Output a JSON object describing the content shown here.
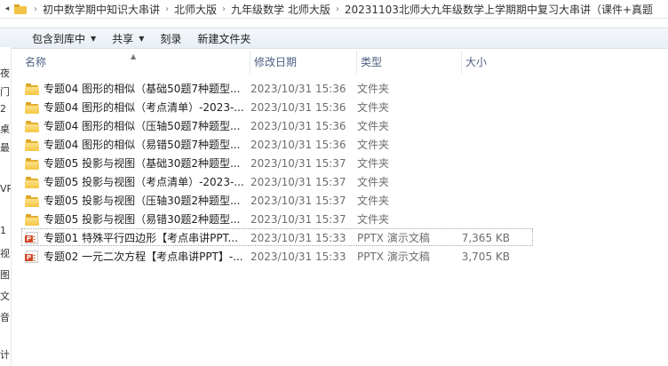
{
  "address_bar": {
    "crumbs": [
      "初中数学期中知识大串讲",
      "北师大版",
      "九年级数学 北师大版",
      "20231103北师大九年级数学上学期期中复习大串讲（课件+真题"
    ]
  },
  "toolbar": {
    "include_library": "包含到库中",
    "share": "共享",
    "burn": "刻录",
    "new_folder": "新建文件夹"
  },
  "columns": {
    "name": "名称",
    "date": "修改日期",
    "type": "类型",
    "size": "大小"
  },
  "left_nav_fragments": [
    "夜",
    "门",
    "2",
    "桌",
    "最",
    "VP",
    "1",
    "视",
    "图",
    "文",
    "音",
    "计"
  ],
  "files": [
    {
      "name": "专题04 图形的相似（基础50题7种题型...",
      "date": "2023/10/31 15:36",
      "type": "文件夹",
      "size": "",
      "icon": "folder-icon"
    },
    {
      "name": "专题04 图形的相似（考点清单）-2023-...",
      "date": "2023/10/31 15:36",
      "type": "文件夹",
      "size": "",
      "icon": "folder-icon"
    },
    {
      "name": "专题04 图形的相似（压轴50题7种题型...",
      "date": "2023/10/31 15:36",
      "type": "文件夹",
      "size": "",
      "icon": "folder-icon"
    },
    {
      "name": "专题04 图形的相似（易错50题7种题型...",
      "date": "2023/10/31 15:36",
      "type": "文件夹",
      "size": "",
      "icon": "folder-icon"
    },
    {
      "name": "专题05 投影与视图（基础30题2种题型...",
      "date": "2023/10/31 15:37",
      "type": "文件夹",
      "size": "",
      "icon": "folder-icon"
    },
    {
      "name": "专题05 投影与视图（考点清单）-2023-...",
      "date": "2023/10/31 15:37",
      "type": "文件夹",
      "size": "",
      "icon": "folder-icon"
    },
    {
      "name": "专题05 投影与视图（压轴30题2种题型...",
      "date": "2023/10/31 15:37",
      "type": "文件夹",
      "size": "",
      "icon": "folder-icon"
    },
    {
      "name": "专题05 投影与视图（易错30题2种题型...",
      "date": "2023/10/31 15:37",
      "type": "文件夹",
      "size": "",
      "icon": "folder-icon"
    },
    {
      "name": "专题01 特殊平行四边形【考点串讲PPT...",
      "date": "2023/10/31 15:33",
      "type": "PPTX 演示文稿",
      "size": "7,365 KB",
      "icon": "pptx-file-icon"
    },
    {
      "name": "专题02 一元二次方程【考点串讲PPT】-...",
      "date": "2023/10/31 15:33",
      "type": "PPTX 演示文稿",
      "size": "3,705 KB",
      "icon": "pptx-file-icon"
    }
  ]
}
